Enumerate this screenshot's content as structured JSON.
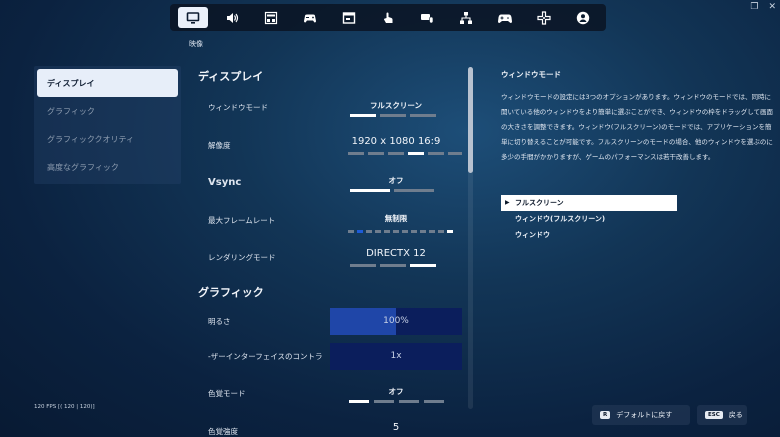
{
  "window": {
    "restore": "❐",
    "close": "✕"
  },
  "topbar": {
    "caption": "映像",
    "tabs": [
      {
        "icon": "monitor-icon",
        "active": true
      },
      {
        "icon": "speaker-icon"
      },
      {
        "icon": "sliders-icon"
      },
      {
        "icon": "controller-icon"
      },
      {
        "icon": "hud-window-icon"
      },
      {
        "icon": "touch-icon"
      },
      {
        "icon": "keyboard-mouse-icon"
      },
      {
        "icon": "network-icon"
      },
      {
        "icon": "gamepad-icon"
      },
      {
        "icon": "dpad-icon"
      },
      {
        "icon": "account-icon"
      }
    ]
  },
  "sidebar": {
    "items": [
      {
        "label": "ディスプレイ",
        "active": true
      },
      {
        "label": "グラフィック"
      },
      {
        "label": "グラフィッククオリティ"
      },
      {
        "label": "高度なグラフィック"
      }
    ]
  },
  "fps_text": "120 FPS [( 120 | 120)]",
  "display": {
    "title": "ディスプレイ",
    "window_mode": {
      "label": "ウィンドウモード",
      "value": "フルスクリーン"
    },
    "resolution": {
      "label": "解像度",
      "value": "1920 x 1080 16:9"
    },
    "vsync": {
      "label": "Vsync",
      "value": "オフ"
    },
    "max_framerate": {
      "label": "最大フレームレート",
      "value": "無制限"
    },
    "rendering_mode": {
      "label": "レンダリングモード",
      "value": "DIRECTX 12"
    }
  },
  "graphics": {
    "title": "グラフィック",
    "brightness": {
      "label": "明るさ",
      "value": "100%",
      "level": 0.5
    },
    "ui_contrast": {
      "label": "-ザーインターフェイスのコントラ",
      "value": "1x",
      "level": 0.0
    },
    "color_vision_mode": {
      "label": "色覚モード",
      "value": "オフ"
    },
    "color_vision_strength": {
      "label": "色覚強度",
      "value": "5"
    }
  },
  "description": {
    "title": "ウィンドウモード",
    "text": "ウィンドウモードの設定には3つのオプションがあります。ウィンドウのモードでは、同時に開いている他のウィンドウをより簡単に選ぶことができ、ウィンドウの枠をドラッグして画面の大きさを調整できます。ウィンドウ(フルスクリーン)のモードでは、アプリケーションを簡単に切り替えることが可能です。フルスクリーンのモードの場合、他のウィンドウを選ぶのに多少の手間がかかりますが、ゲームのパフォーマンスは若干改善します。",
    "options": [
      {
        "label": "フルスクリーン",
        "selected": true
      },
      {
        "label": "ウィンドウ(フルスクリーン)"
      },
      {
        "label": "ウィンドウ"
      }
    ]
  },
  "footer": {
    "reset_key": "R",
    "reset_label": "デフォルトに戻す",
    "back_key": "ESC",
    "back_label": "戻る"
  },
  "colors": {
    "accent": "#1f46a8",
    "slider_track": "#0b1e5c",
    "active_bg": "#e7eef9"
  }
}
